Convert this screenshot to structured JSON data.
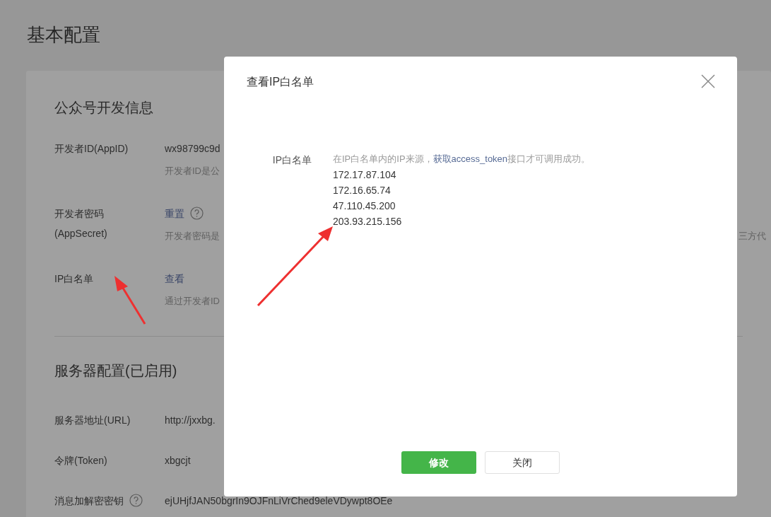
{
  "page_title": "基本配置",
  "sections": [
    {
      "title": "公众号开发信息",
      "rows": [
        {
          "label": "开发者ID(AppID)",
          "value": "wx98799c9d",
          "kind": "text",
          "help": false,
          "hint": "开发者ID是公"
        },
        {
          "label": "开发者密码(AppSecret)",
          "value": "重置",
          "kind": "link",
          "help": true,
          "hint": "开发者密码是",
          "hint_tail": "三方代"
        },
        {
          "label": "IP白名单",
          "value": "查看",
          "kind": "link",
          "help": false,
          "hint": "通过开发者ID"
        }
      ]
    },
    {
      "title": "服务器配置(已启用)",
      "rows": [
        {
          "label": "服务器地址(URL)",
          "value": "http://jxxbg.",
          "kind": "text",
          "help": false
        },
        {
          "label": "令牌(Token)",
          "value": "xbgcjt",
          "kind": "text",
          "help": false
        },
        {
          "label": "消息加解密密钥",
          "value": "ejUHjfJAN50bgrIn9OJFnLiVrChed9eleVDywpt8OEe",
          "kind": "text",
          "help": true
        }
      ]
    }
  ],
  "dialog": {
    "title": "查看IP白名单",
    "field_label": "IP白名单",
    "note_before": "在IP白名单内的IP来源，",
    "note_link": "获取access_token",
    "note_after": "接口才可调用成功。",
    "ips": [
      "172.17.87.104",
      "172.16.65.74",
      "47.110.45.200",
      "203.93.215.156"
    ],
    "buttons": [
      {
        "label": "修改",
        "kind": "primary"
      },
      {
        "label": "关闭",
        "kind": "default"
      }
    ]
  }
}
